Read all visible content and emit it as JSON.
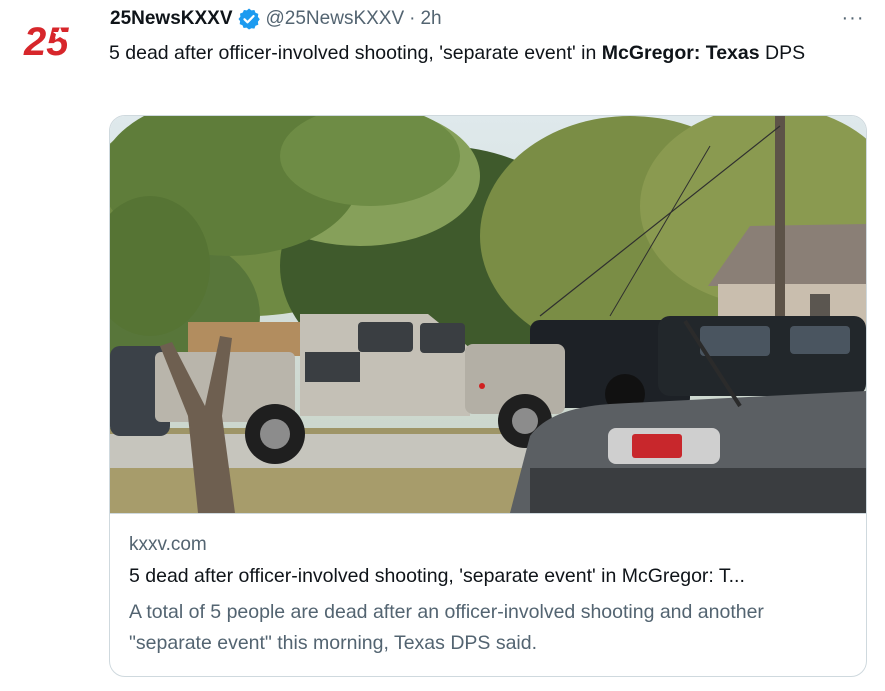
{
  "tweet": {
    "display_name": "25NewsKXXV",
    "handle": "@25NewsKXXV",
    "separator": "·",
    "time": "2h",
    "text_plain": "5 dead after officer-involved shooting, 'separate event' in ",
    "text_bold": "McGregor: Texas",
    "text_tail": " DPS",
    "avatar_text": "25",
    "more_icon": "···"
  },
  "card": {
    "domain": "kxxv.com",
    "title": "5 dead after officer-involved shooting, 'separate event' in McGregor: T...",
    "description": "A total of 5 people are dead after an officer-involved shooting and another \"separate event\" this morning, Texas DPS said."
  },
  "colors": {
    "verified": "#1d9bf0",
    "avatar_red": "#d7262b",
    "text_secondary": "#536471",
    "border": "#cfd9de"
  }
}
